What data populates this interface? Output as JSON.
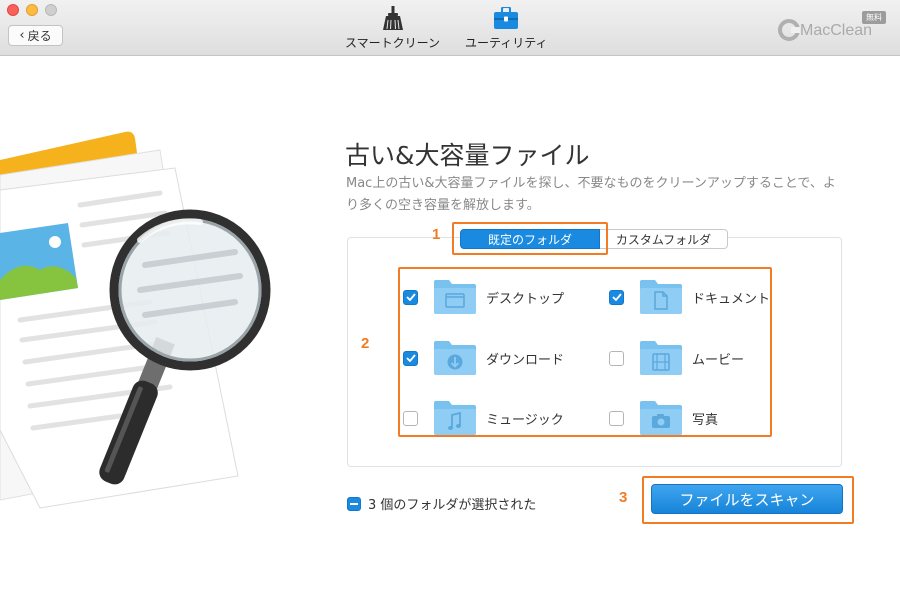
{
  "titlebar": {
    "back_label": "戻る",
    "tools": [
      {
        "label": "スマートクリーン",
        "icon": "broom-icon"
      },
      {
        "label": "ユーティリティ",
        "icon": "toolbox-icon"
      }
    ],
    "brand_name": "MacClean",
    "brand_badge": "無料"
  },
  "main": {
    "title": "古い&大容量ファイル",
    "description": "Mac上の古い&大容量ファイルを探し、不要なものをクリーンアップすることで、より多くの空き容量を解放します。",
    "tabs": [
      {
        "label": "既定のフォルダ",
        "active": true
      },
      {
        "label": "カスタムフォルダ",
        "active": false
      }
    ],
    "folders": [
      {
        "label": "デスクトップ",
        "checked": true,
        "icon": "desktop-folder-icon"
      },
      {
        "label": "ドキュメント",
        "checked": true,
        "icon": "documents-folder-icon"
      },
      {
        "label": "ダウンロード",
        "checked": true,
        "icon": "downloads-folder-icon"
      },
      {
        "label": "ムービー",
        "checked": false,
        "icon": "movies-folder-icon"
      },
      {
        "label": "ミュージック",
        "checked": false,
        "icon": "music-folder-icon"
      },
      {
        "label": "写真",
        "checked": false,
        "icon": "photos-folder-icon"
      }
    ],
    "summary": "3 個のフォルダが選択された",
    "scan_button": "ファイルをスキャン",
    "steps": [
      "1",
      "2",
      "3"
    ]
  },
  "colors": {
    "accent": "#1a8ae0",
    "highlight": "#f27c24",
    "folder": "#6db9ec"
  }
}
